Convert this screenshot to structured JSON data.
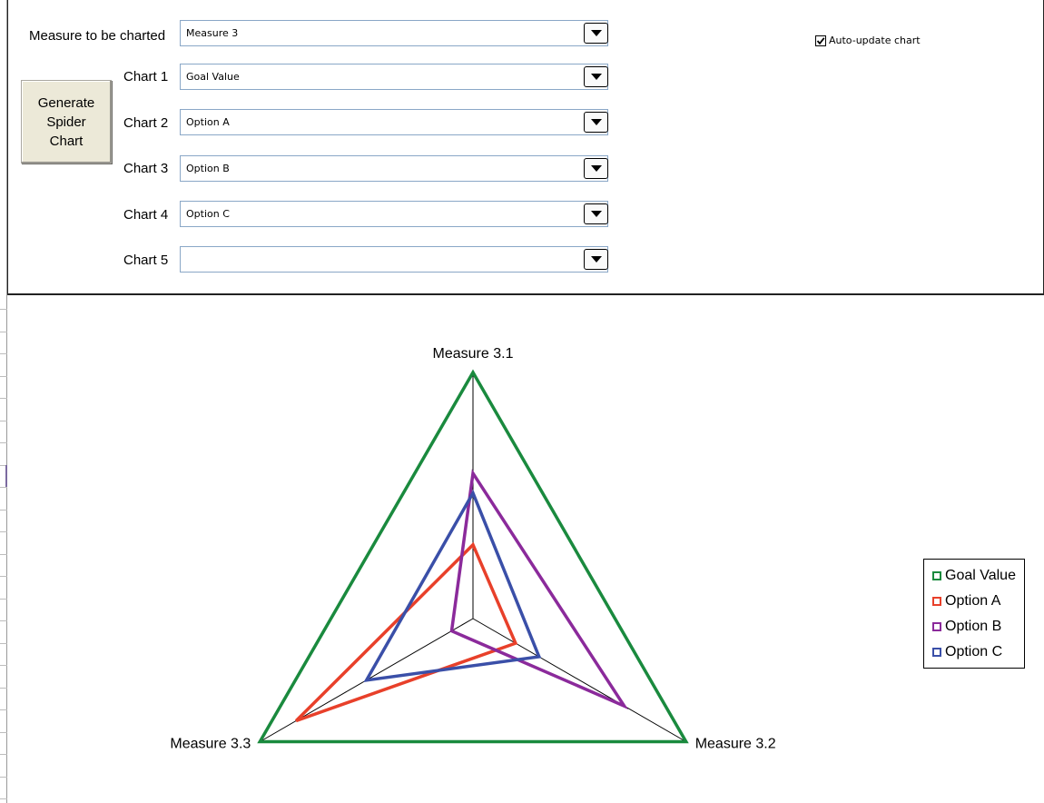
{
  "controls": {
    "measure_label": "Measure to be charted",
    "measure_value": "Measure 3",
    "generate_button": "Generate\nSpider\nChart",
    "auto_update_label": "Auto-update chart",
    "auto_update_checked": true,
    "charts": [
      {
        "label": "Chart 1",
        "value": "Goal Value"
      },
      {
        "label": "Chart 2",
        "value": "Option A"
      },
      {
        "label": "Chart 3",
        "value": "Option B"
      },
      {
        "label": "Chart 4",
        "value": "Option C"
      },
      {
        "label": "Chart 5",
        "value": ""
      }
    ]
  },
  "chart_data": {
    "type": "radar",
    "axes": [
      "Measure 3.1",
      "Measure 3.2",
      "Measure 3.3"
    ],
    "range": [
      0,
      1
    ],
    "series": [
      {
        "name": "Goal Value",
        "color": "#1a8a3e",
        "values": [
          1.0,
          1.0,
          1.0
        ]
      },
      {
        "name": "Option A",
        "color": "#e8402a",
        "values": [
          0.3,
          0.2,
          0.83
        ]
      },
      {
        "name": "Option B",
        "color": "#8b2a9b",
        "values": [
          0.59,
          0.71,
          0.1
        ]
      },
      {
        "name": "Option C",
        "color": "#3a4fa8",
        "values": [
          0.51,
          0.31,
          0.5
        ]
      }
    ]
  }
}
